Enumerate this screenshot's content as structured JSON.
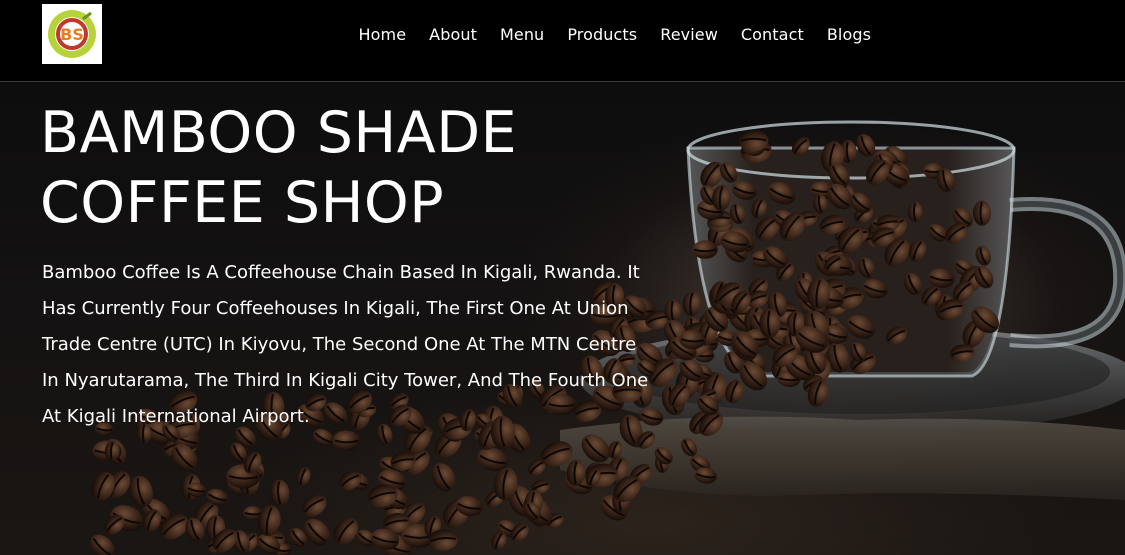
{
  "brand": {
    "logo_alt": "BS",
    "logo_colors": {
      "ring": "#b7d33b",
      "inner": "#c0392b",
      "accent": "#e67e22"
    }
  },
  "nav": {
    "items": [
      {
        "label": "Home"
      },
      {
        "label": "About"
      },
      {
        "label": "Menu"
      },
      {
        "label": "Products"
      },
      {
        "label": "Review"
      },
      {
        "label": "Contact"
      },
      {
        "label": "Blogs"
      }
    ]
  },
  "hero": {
    "title": "BAMBOO SHADE COFFEE SHOP",
    "description": "Bamboo Coffee Is A Coffeehouse Chain Based In Kigali, Rwanda. It Has Currently Four Coffeehouses In Kigali, The First One At Union Trade Centre (UTC) In Kiyovu, The Second One At The MTN Centre In Nyarutarama, The Third In Kigali City Tower, And The Fourth One At Kigali International Airport.",
    "image": "coffee-beans-in-glass-cup"
  },
  "colors": {
    "header_bg": "#000000",
    "text": "#ffffff"
  }
}
